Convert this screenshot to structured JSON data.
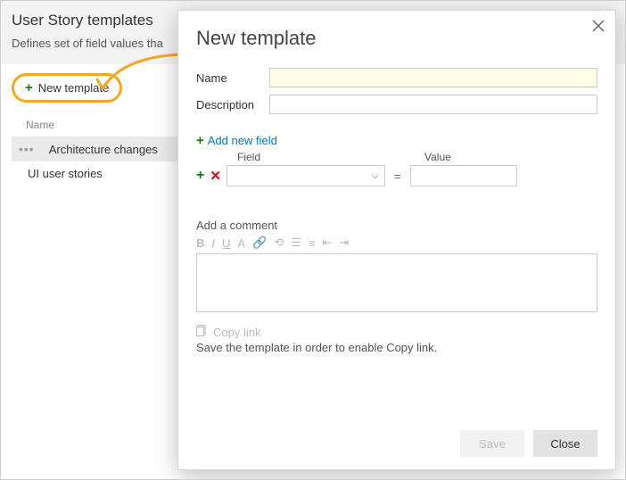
{
  "page": {
    "title": "User Story templates",
    "subtitle": "Defines set of field values tha"
  },
  "sidebar": {
    "new_template_label": "New template",
    "column_header": "Name",
    "items": [
      {
        "label": "Architecture changes",
        "selected": true
      },
      {
        "label": "UI user stories",
        "selected": false
      }
    ]
  },
  "dialog": {
    "title": "New template",
    "name_label": "Name",
    "description_label": "Description",
    "add_new_field_label": "Add new field",
    "field_header": "Field",
    "value_header": "Value",
    "equals": "=",
    "comment_label": "Add a comment",
    "copy_link_label": "Copy link",
    "copy_link_hint": "Save the template in order to enable Copy link.",
    "save_label": "Save",
    "close_label": "Close"
  }
}
